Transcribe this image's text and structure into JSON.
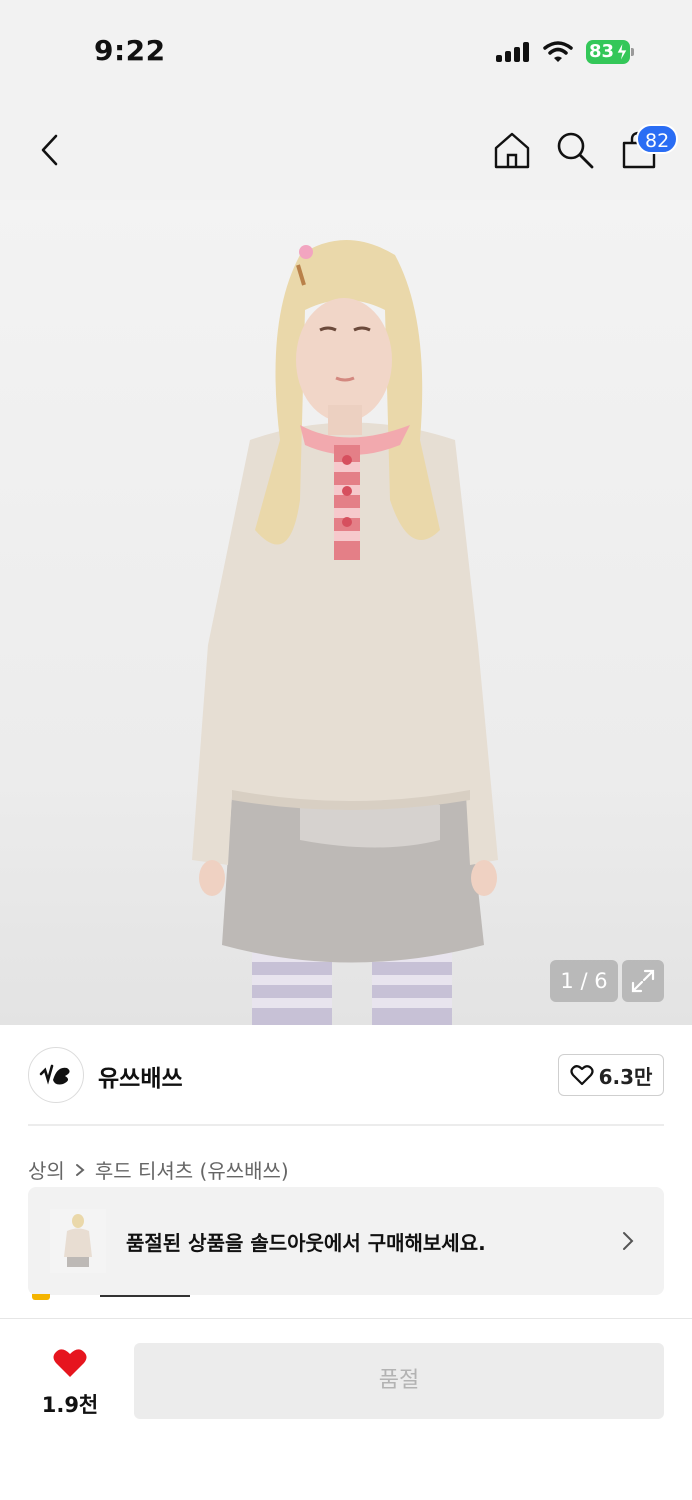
{
  "status_bar": {
    "time": "9:22",
    "battery": "83",
    "icons": [
      "cellular-signal-icon",
      "wifi-icon",
      "battery-charging-icon"
    ]
  },
  "nav": {
    "icons": [
      "back-icon",
      "home-icon",
      "search-icon",
      "cart-icon"
    ],
    "cart_count": "82"
  },
  "gallery": {
    "counter": "1 / 6",
    "expand_icon": "expand-icon"
  },
  "brand": {
    "name": "유쓰배쓰",
    "likes": "6.3만"
  },
  "breadcrumb": {
    "category": "상의",
    "subcategory": "후드 티셔츠 (유쓰배쓰)"
  },
  "soldout_banner": {
    "text": "품절된 상품을 솔드아웃에서 구매해보세요."
  },
  "bottom_bar": {
    "wish_count": "1.9천",
    "buy_button": "품절"
  },
  "colors": {
    "accent_blue": "#2a6df4",
    "heart_red": "#e6151e",
    "battery_green": "#34c759"
  }
}
